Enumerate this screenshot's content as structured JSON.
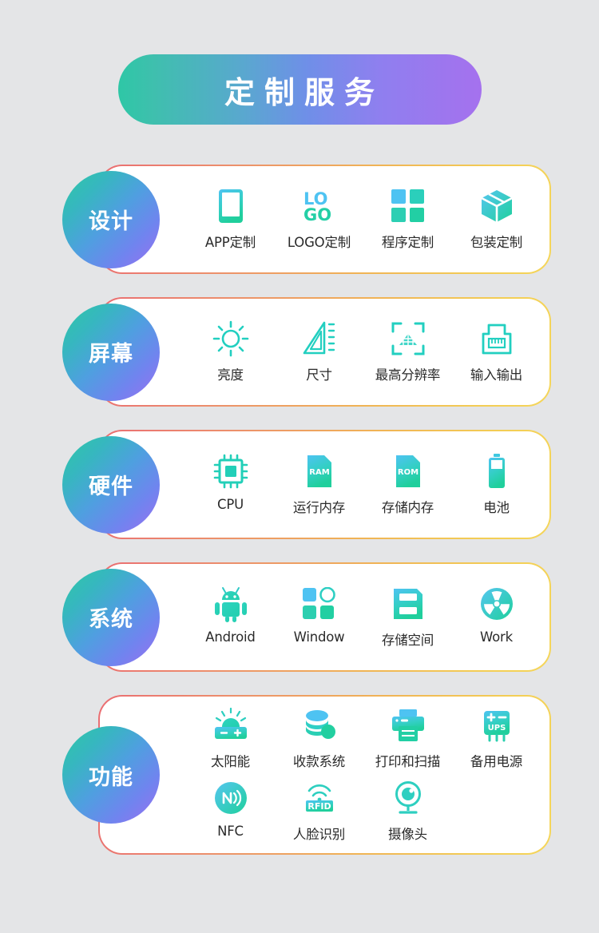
{
  "header": {
    "title": "定制服务",
    "gradient_from": "#2ec7a6",
    "gradient_to": "#a571ee"
  },
  "theme": {
    "background": "#e4e5e7",
    "card_background": "#ffffff",
    "badge_gradient_from": "#2ec9a4",
    "badge_gradient_to": "#9b6ff0",
    "card_border_from": "#ea6d72",
    "card_border_to": "#f5d65a",
    "icon_gradient_from": "#4bc0f0",
    "icon_gradient_to": "#25d0a2",
    "label_color": "#2a2a2a"
  },
  "sections": [
    {
      "id": "design",
      "badge": "设计",
      "rows": [
        [
          {
            "label": "APP定制",
            "icon": "phone-icon"
          },
          {
            "label": "LOGO定制",
            "icon": "logo-icon"
          },
          {
            "label": "程序定制",
            "icon": "grid-squares-icon"
          },
          {
            "label": "包装定制",
            "icon": "package-box-icon"
          }
        ]
      ]
    },
    {
      "id": "screen",
      "badge": "屏幕",
      "rows": [
        [
          {
            "label": "亮度",
            "icon": "sun-brightness-icon"
          },
          {
            "label": "尺寸",
            "icon": "ruler-triangle-icon"
          },
          {
            "label": "最高分辨率",
            "icon": "resolution-scan-icon"
          },
          {
            "label": "输入输出",
            "icon": "ethernet-port-icon"
          }
        ]
      ]
    },
    {
      "id": "hardware",
      "badge": "硬件",
      "rows": [
        [
          {
            "label": "CPU",
            "icon": "cpu-chip-icon"
          },
          {
            "label": "运行内存",
            "icon": "ram-card-icon"
          },
          {
            "label": "存储内存",
            "icon": "rom-card-icon"
          },
          {
            "label": "电池",
            "icon": "battery-icon"
          }
        ]
      ]
    },
    {
      "id": "system",
      "badge": "系统",
      "rows": [
        [
          {
            "label": "Android",
            "icon": "android-robot-icon"
          },
          {
            "label": "Window",
            "icon": "windows-tiles-icon"
          },
          {
            "label": "存储空间",
            "icon": "storage-drive-icon"
          },
          {
            "label": "Work",
            "icon": "radiation-work-icon"
          }
        ]
      ]
    },
    {
      "id": "function",
      "badge": "功能",
      "rows": [
        [
          {
            "label": "太阳能",
            "icon": "solar-battery-icon"
          },
          {
            "label": "收款系统",
            "icon": "coins-stack-icon"
          },
          {
            "label": "打印和扫描",
            "icon": "printer-icon"
          },
          {
            "label": "备用电源",
            "icon": "ups-power-icon"
          }
        ],
        [
          {
            "label": "NFC",
            "icon": "nfc-icon"
          },
          {
            "label": "人脸识别",
            "icon": "rfid-badge-icon"
          },
          {
            "label": "摄像头",
            "icon": "camera-icon"
          }
        ]
      ]
    }
  ]
}
